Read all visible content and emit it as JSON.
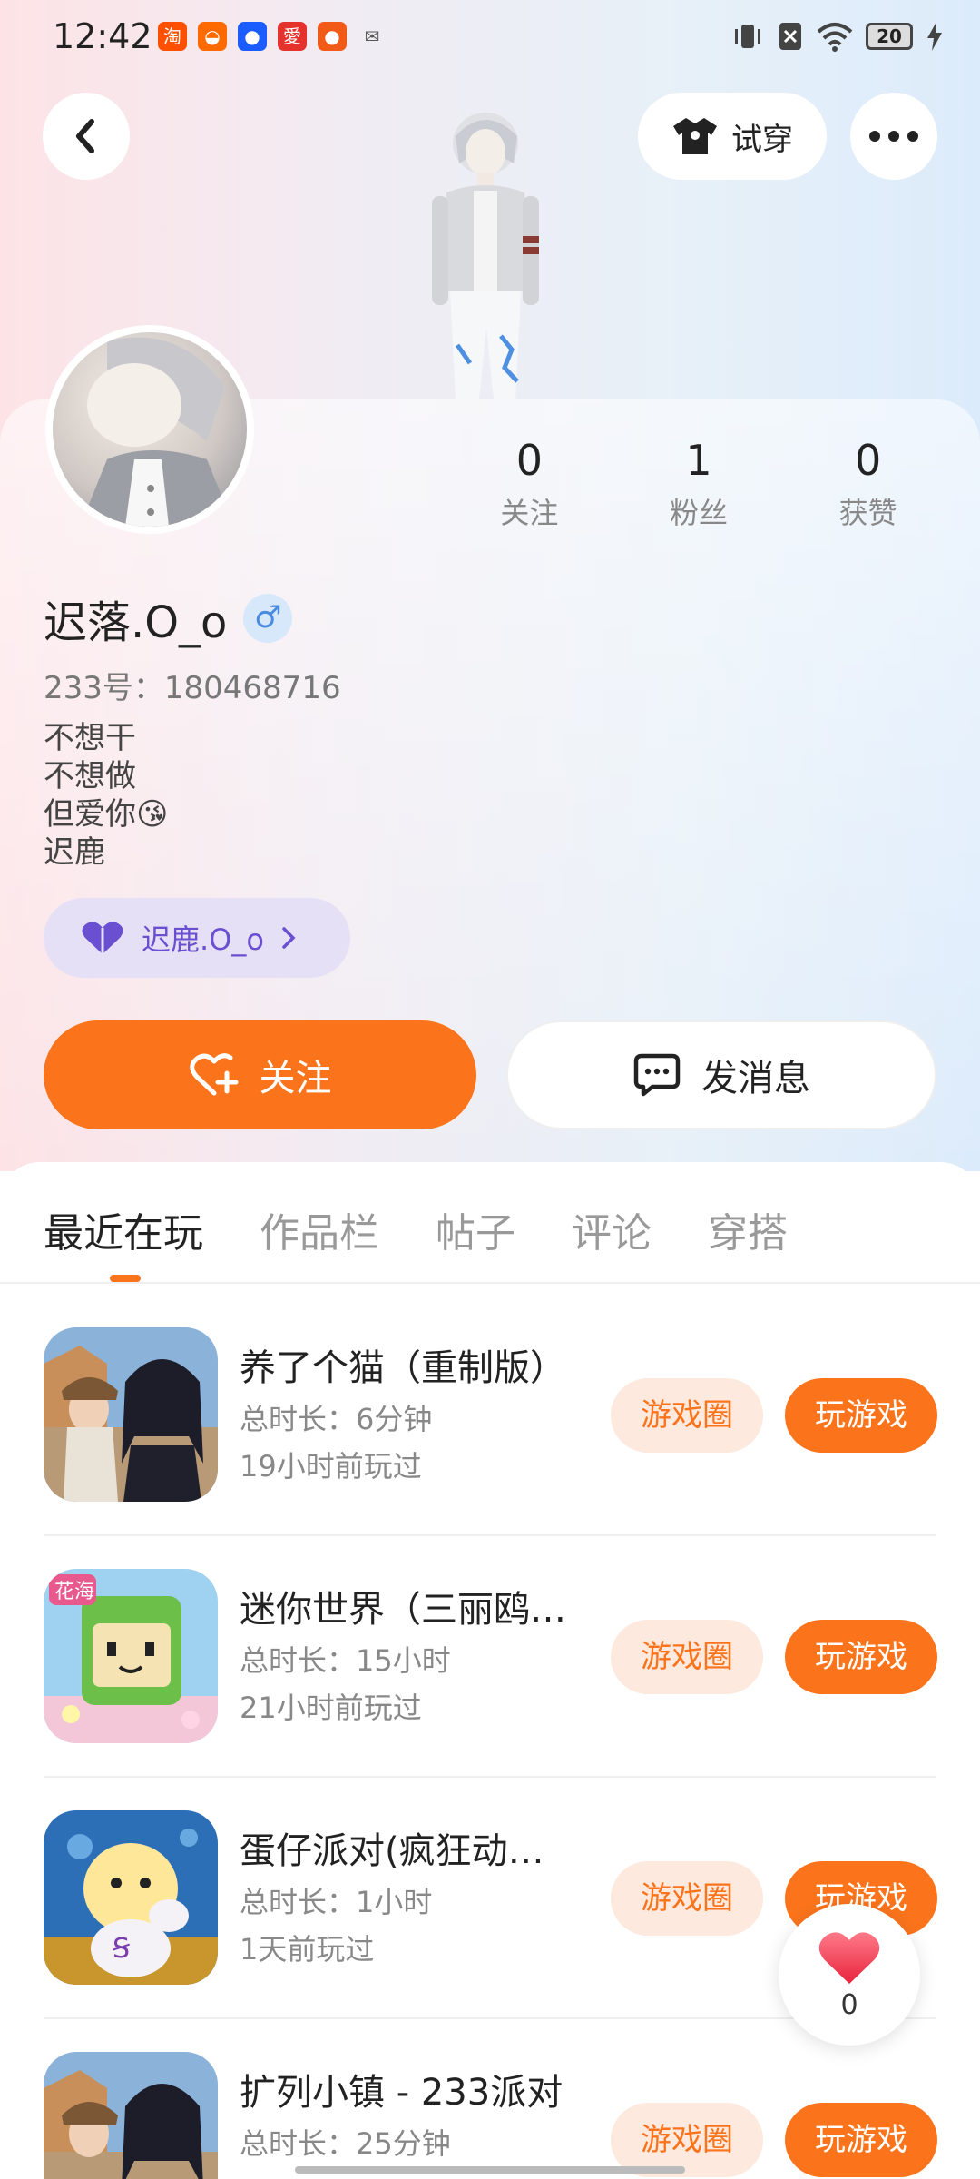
{
  "status_bar": {
    "time": "12:42",
    "battery": "20",
    "notifications": [
      {
        "name": "taobao-icon",
        "glyph": "淘",
        "color": "#ff5000"
      },
      {
        "name": "orange-app-icon",
        "glyph": "◒",
        "color": "#ff6a00"
      },
      {
        "name": "blue-dot-app-icon",
        "glyph": "●",
        "color": "#1a5cff"
      },
      {
        "name": "red-app-icon",
        "glyph": "愛",
        "color": "#e5322d"
      },
      {
        "name": "ball-app-icon",
        "glyph": "●",
        "color": "#f25a18"
      },
      {
        "name": "wechat-icon",
        "glyph": "✉",
        "color": "#555"
      }
    ]
  },
  "header": {
    "tryon_label": "试穿"
  },
  "profile": {
    "username": "迟落.O_o",
    "gender_symbol": "♂",
    "uid": "233号：180468716",
    "bio": [
      "不想干",
      "不想做",
      "但爱你😘",
      "迟鹿"
    ],
    "relation_chip": "迟鹿.O_o",
    "stats": [
      {
        "value": "0",
        "label": "关注"
      },
      {
        "value": "1",
        "label": "粉丝"
      },
      {
        "value": "0",
        "label": "获赞"
      }
    ],
    "follow_label": "关注",
    "message_label": "发消息"
  },
  "tabs": [
    "最近在玩",
    "作品栏",
    "帖子",
    "评论",
    "穿搭"
  ],
  "games": [
    {
      "name": "养了个猫（重制版）",
      "duration": "总时长：6分钟",
      "last_played": "19小时前玩过",
      "circle_label": "游戏圈",
      "play_label": "玩游戏"
    },
    {
      "name": "迷你世界（三丽鸥…",
      "duration": "总时长：15小时",
      "last_played": "21小时前玩过",
      "circle_label": "游戏圈",
      "play_label": "玩游戏"
    },
    {
      "name": "蛋仔派对(疯狂动…",
      "duration": "总时长：1小时",
      "last_played": "1天前玩过",
      "circle_label": "游戏圈",
      "play_label": "玩游戏"
    },
    {
      "name": "扩列小镇 - 233派对",
      "duration": "总时长：25分钟",
      "last_played": "",
      "circle_label": "游戏圈",
      "play_label": "玩游戏"
    }
  ],
  "like_fab": {
    "count": "0"
  },
  "colors": {
    "accent": "#fb741c",
    "accent_light": "#fde9dd",
    "chip_bg": "#e6e0f6",
    "chip_text": "#6a4fd0"
  }
}
